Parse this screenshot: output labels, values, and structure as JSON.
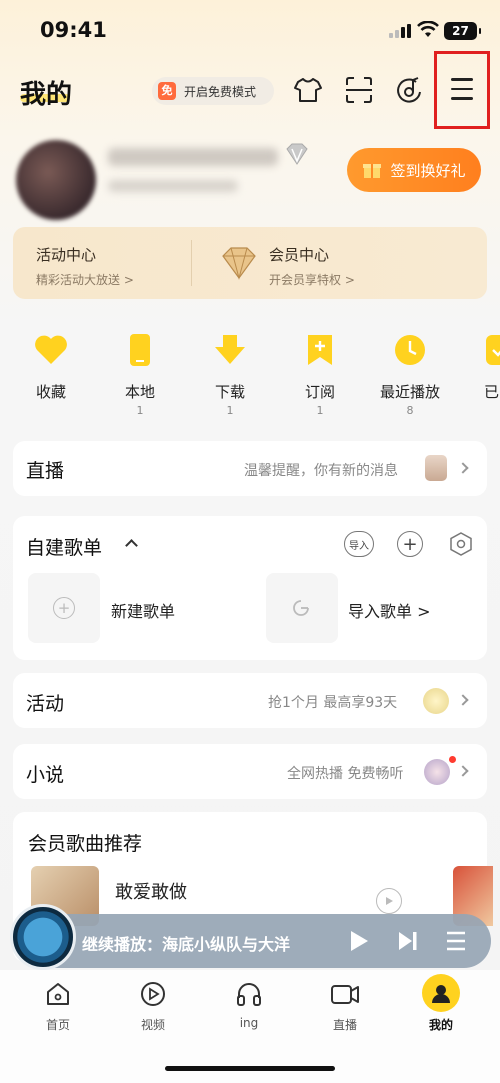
{
  "status_bar": {
    "time": "09:41",
    "battery": "27"
  },
  "header": {
    "title": "我的",
    "free_badge": "免",
    "free_mode_label": "开启免费模式"
  },
  "profile": {
    "signin_label": "签到换好礼"
  },
  "promo_cards": [
    {
      "title": "活动中心",
      "subtitle": "精彩活动大放送 >"
    },
    {
      "title": "会员中心",
      "subtitle": "开会员享特权 >"
    }
  ],
  "quick_actions": [
    {
      "label": "收藏",
      "count": ""
    },
    {
      "label": "本地",
      "count": "1"
    },
    {
      "label": "下载",
      "count": "1"
    },
    {
      "label": "订阅",
      "count": "1"
    },
    {
      "label": "最近播放",
      "count": "8"
    },
    {
      "label": "已",
      "count": ""
    }
  ],
  "live": {
    "title": "直播",
    "hint": "温馨提醒，你有新的消息"
  },
  "playlists": {
    "title": "自建歌单",
    "import_btn": "导入",
    "items": [
      {
        "label": "新建歌单"
      },
      {
        "label": "导入歌单 >"
      }
    ]
  },
  "activity": {
    "title": "活动",
    "hint": "抢1个月 最高享93天"
  },
  "novel": {
    "title": "小说",
    "hint": "全网热播 免费畅听"
  },
  "vip_songs": {
    "title": "会员歌曲推荐",
    "song_title": "敢爱敢做"
  },
  "player": {
    "text": "继续播放：海底小纵队与大洋"
  },
  "tabs": [
    {
      "label": "首页"
    },
    {
      "label": "视频"
    },
    {
      "label": "ing"
    },
    {
      "label": "直播"
    },
    {
      "label": "我的"
    }
  ],
  "colors": {
    "accent_yellow": "#ffd21f",
    "signin_orange": "#ff8a25",
    "highlight_red": "#e0201f"
  }
}
